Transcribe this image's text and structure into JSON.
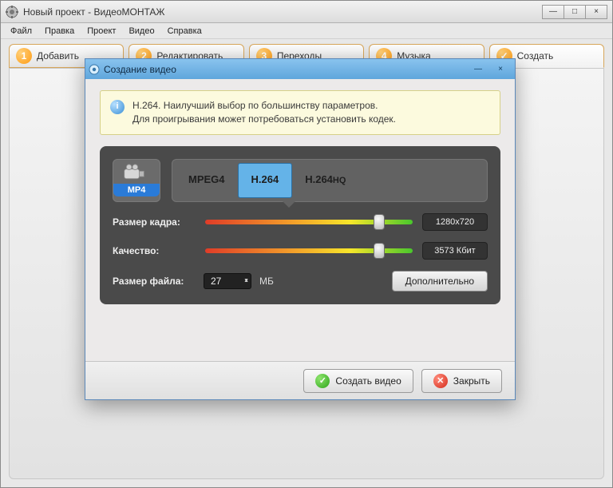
{
  "window": {
    "title": "Новый проект - ВидеоМОНТАЖ",
    "controls": {
      "min": "—",
      "max": "□",
      "close": "×"
    }
  },
  "menubar": [
    "Файл",
    "Правка",
    "Проект",
    "Видео",
    "Справка"
  ],
  "tabs": [
    {
      "num": "1",
      "label": "Добавить"
    },
    {
      "num": "2",
      "label": "Редактировать"
    },
    {
      "num": "3",
      "label": "Переходы"
    },
    {
      "num": "4",
      "label": "Музыка"
    },
    {
      "num": "✓",
      "label": "Создать"
    }
  ],
  "modal": {
    "title": "Создание видео",
    "controls": {
      "min": "—",
      "close": "×"
    },
    "info_line1": "H.264. Наилучший выбор по большинству параметров.",
    "info_line2": "Для проигрывания может потребоваться установить кодек.",
    "format_label": "MP4",
    "codecs": [
      {
        "label": "MPEG4",
        "selected": false
      },
      {
        "label": "H.264",
        "selected": true
      },
      {
        "label": "H.264",
        "sub": "HQ",
        "selected": false
      }
    ],
    "frame_size": {
      "label": "Размер кадра:",
      "value": "1280x720",
      "pos_pct": 81
    },
    "quality": {
      "label": "Качество:",
      "value": "3573 Кбит",
      "pos_pct": 81
    },
    "file_size": {
      "label": "Размер файла:",
      "value": "27",
      "unit": "МБ"
    },
    "advanced_label": "Дополнительно",
    "footer": {
      "create": "Создать видео",
      "close": "Закрыть"
    }
  }
}
